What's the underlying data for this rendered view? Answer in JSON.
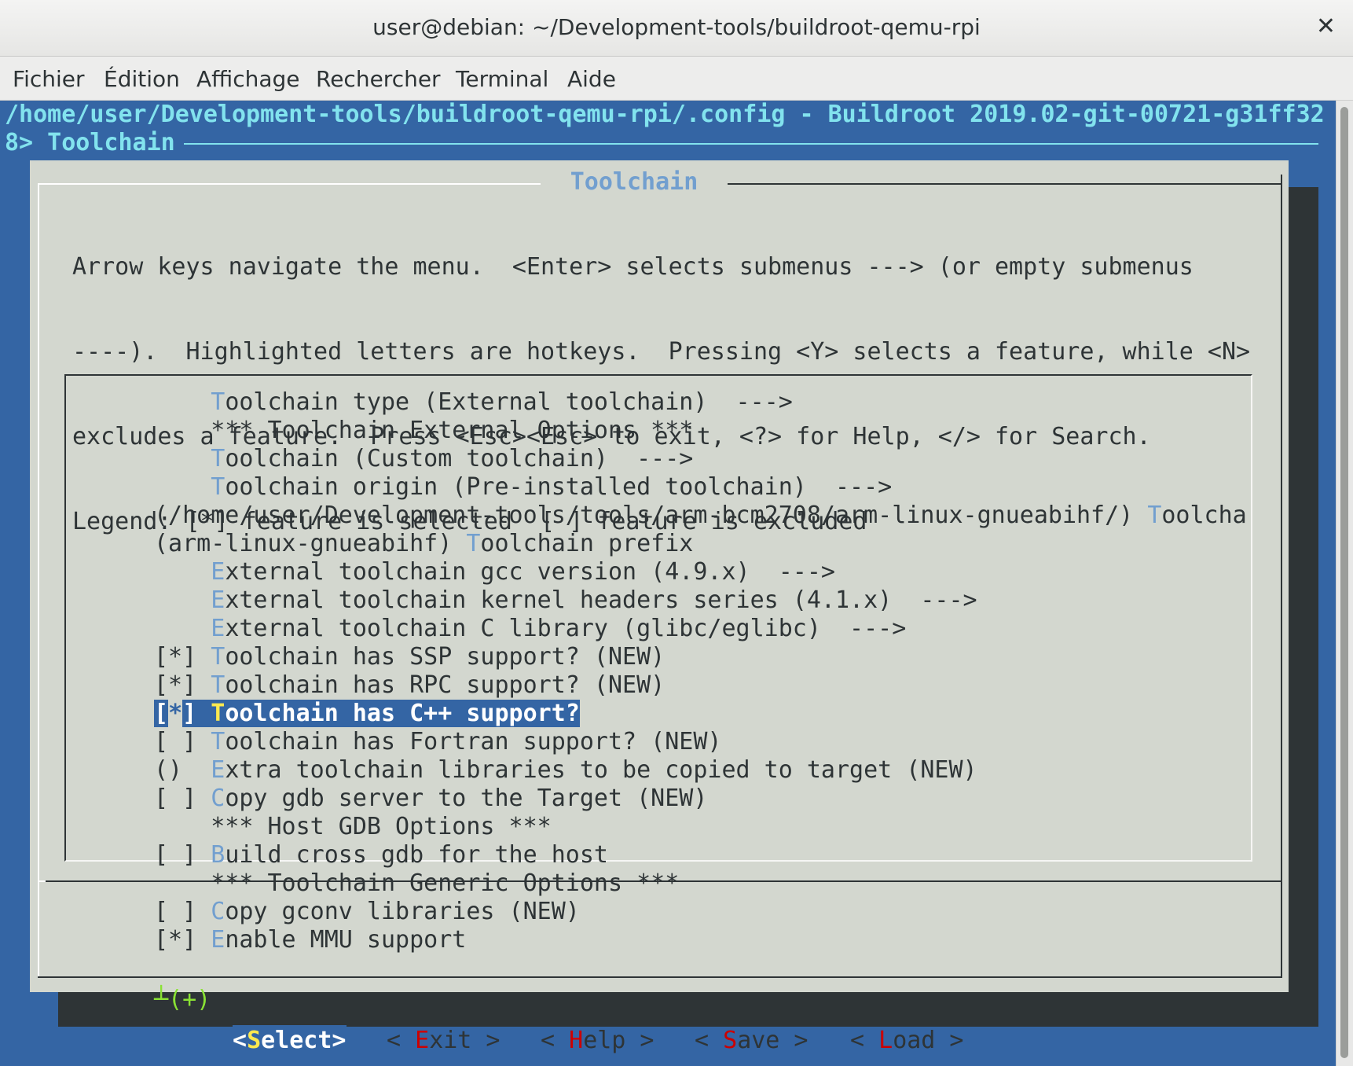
{
  "window": {
    "title": "user@debian: ~/Development-tools/buildroot-qemu-rpi",
    "close_glyph": "✕"
  },
  "menubar": [
    "Fichier",
    "Édition",
    "Affichage",
    "Rechercher",
    "Terminal",
    "Aide"
  ],
  "terminal": {
    "header_line1": "/home/user/Development-tools/buildroot-qemu-rpi/.config - Buildroot 2019.02-git-00721-g31ff32",
    "header_line2": "8> Toolchain"
  },
  "dialog": {
    "title": "Toolchain",
    "help_lines": [
      "Arrow keys navigate the menu.  <Enter> selects submenus ---> (or empty submenus",
      "----).  Highlighted letters are hotkeys.  Pressing <Y> selects a feature, while <N>",
      "excludes a feature.  Press <Esc><Esc> to exit, <?> for Help, </> for Search.",
      "Legend: [*] feature is selected  [ ] feature is excluded"
    ],
    "items": [
      {
        "pre": "    ",
        "hot": "T",
        "rest": "oolchain type (External toolchain)  --->"
      },
      {
        "pre": "    ",
        "hot": "",
        "rest": "*** Toolchain External Options ***"
      },
      {
        "pre": "    ",
        "hot": "T",
        "rest": "oolchain (Custom toolchain)  --->"
      },
      {
        "pre": "    ",
        "hot": "T",
        "rest": "oolchain origin (Pre-installed toolchain)  --->"
      },
      {
        "pre": "(/home/user/Development-tools/tools/arm-bcm2708/arm-linux-gnueabihf/) ",
        "hot": "T",
        "rest": "oolcha"
      },
      {
        "pre": "(arm-linux-gnueabihf) ",
        "hot": "T",
        "rest": "oolchain prefix"
      },
      {
        "pre": "    ",
        "hot": "E",
        "rest": "xternal toolchain gcc version (4.9.x)  --->"
      },
      {
        "pre": "    ",
        "hot": "E",
        "rest": "xternal toolchain kernel headers series (4.1.x)  --->"
      },
      {
        "pre": "    ",
        "hot": "E",
        "rest": "xternal toolchain C library (glibc/eglibc)  --->"
      },
      {
        "pre": "[*] ",
        "hot": "T",
        "rest": "oolchain has SSP support? (NEW)"
      },
      {
        "pre": "[*] ",
        "hot": "T",
        "rest": "oolchain has RPC support? (NEW)"
      },
      {
        "pre": "[*] ",
        "hot": "T",
        "rest": "oolchain has C++ support?",
        "selected": true
      },
      {
        "pre": "[ ] ",
        "hot": "T",
        "rest": "oolchain has Fortran support? (NEW)"
      },
      {
        "pre": "()  ",
        "hot": "E",
        "rest": "xtra toolchain libraries to be copied to target (NEW)"
      },
      {
        "pre": "[ ] ",
        "hot": "C",
        "rest": "opy gdb server to the Target (NEW)"
      },
      {
        "pre": "    ",
        "hot": "",
        "rest": "*** Host GDB Options ***"
      },
      {
        "pre": "[ ] ",
        "hot": "B",
        "rest": "uild cross gdb for the host"
      },
      {
        "pre": "    ",
        "hot": "",
        "rest": "*** Toolchain Generic Options ***"
      },
      {
        "pre": "[ ] ",
        "hot": "C",
        "rest": "opy gconv libraries (NEW)"
      },
      {
        "pre": "[*] ",
        "hot": "E",
        "rest": "nable MMU support"
      }
    ],
    "more_indicator": "┴(+)",
    "buttons": [
      {
        "a": "<",
        "hk": "S",
        "b": "elect>",
        "active": true
      },
      {
        "a": "< ",
        "hk": "E",
        "b": "xit >"
      },
      {
        "a": "< ",
        "hk": "H",
        "b": "elp >"
      },
      {
        "a": "< ",
        "hk": "S",
        "b": "ave >"
      },
      {
        "a": "< ",
        "hk": "L",
        "b": "oad >"
      }
    ]
  }
}
